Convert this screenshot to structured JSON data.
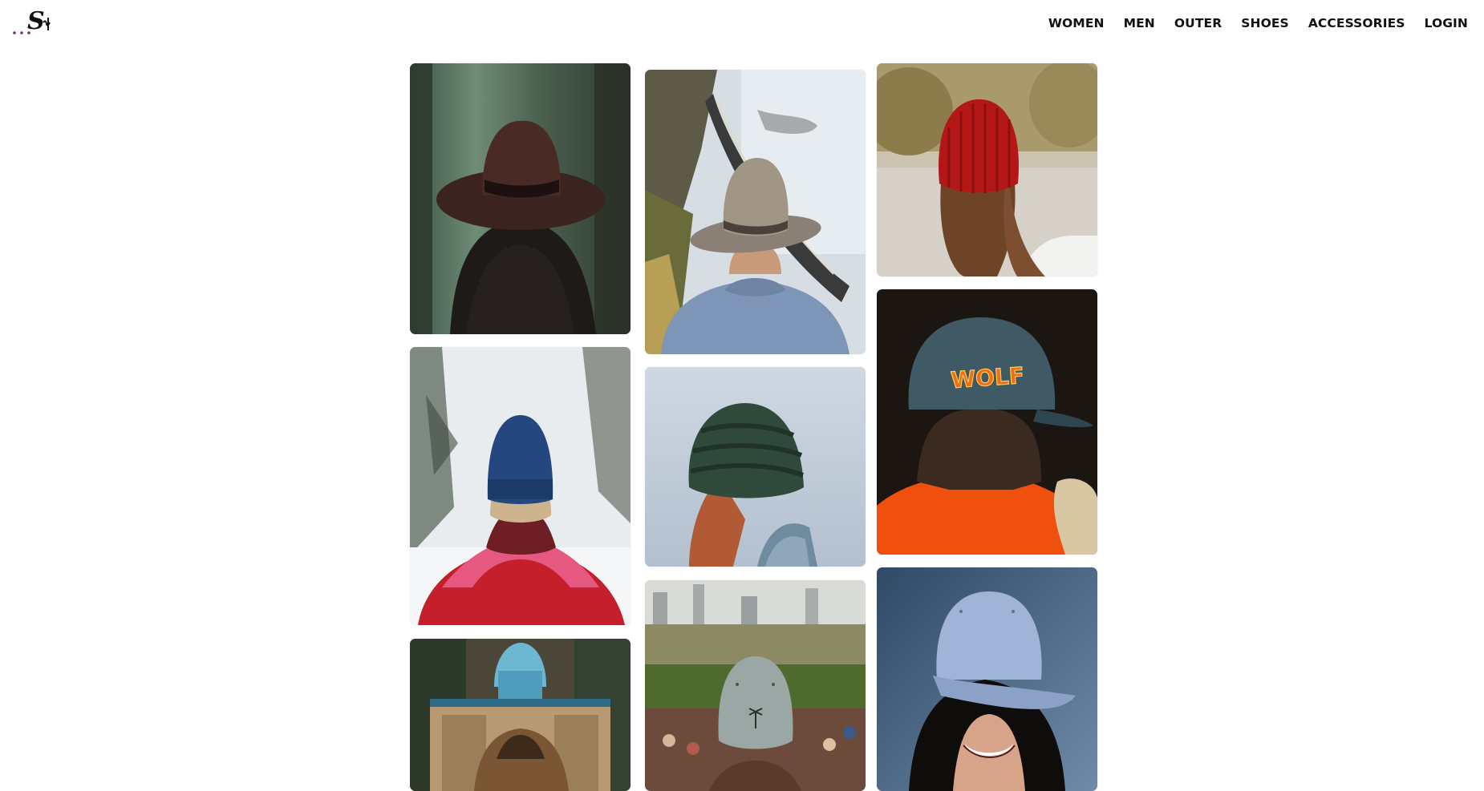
{
  "brand": {
    "logo_text": "S",
    "logo_icon": "brand-logo"
  },
  "nav": {
    "items": [
      {
        "label": "WOMEN"
      },
      {
        "label": "MEN"
      },
      {
        "label": "OUTER"
      },
      {
        "label": "SHOES"
      },
      {
        "label": "ACCESSORIES"
      },
      {
        "label": "LOGIN"
      }
    ]
  },
  "gallery": {
    "items": [
      {
        "subject": "brown fedora, dark hair, forest",
        "hat_color": "#4a2a24"
      },
      {
        "subject": "blue knit beanie, pink-red jacket, snow",
        "hat_color": "#23477e"
      },
      {
        "subject": "tan fedora, mosque backdrop",
        "hat_color": "#7b5635"
      },
      {
        "subject": "grey cowboy hat, blue sweater, coastal road",
        "hat_color": "#9a8f84"
      },
      {
        "subject": "dark green knit beanie, cloudy sky",
        "hat_color": "#2f4a3a"
      },
      {
        "subject": "grey baseball cap, city park",
        "hat_color": "#9aa7a5"
      },
      {
        "subject": "red knit beanie, lakeside",
        "hat_color": "#b31717"
      },
      {
        "subject": "teal five-panel cap with WOLF patch, orange jacket",
        "hat_color": "#3f5a64",
        "patch_text": "WOLF"
      },
      {
        "subject": "light blue baseball cap, smiling face",
        "hat_color": "#9fb4d6"
      }
    ]
  },
  "colors": {
    "logo_dots": "#7b2d6b",
    "nav_text": "#111111",
    "page_bg": "#ffffff"
  }
}
